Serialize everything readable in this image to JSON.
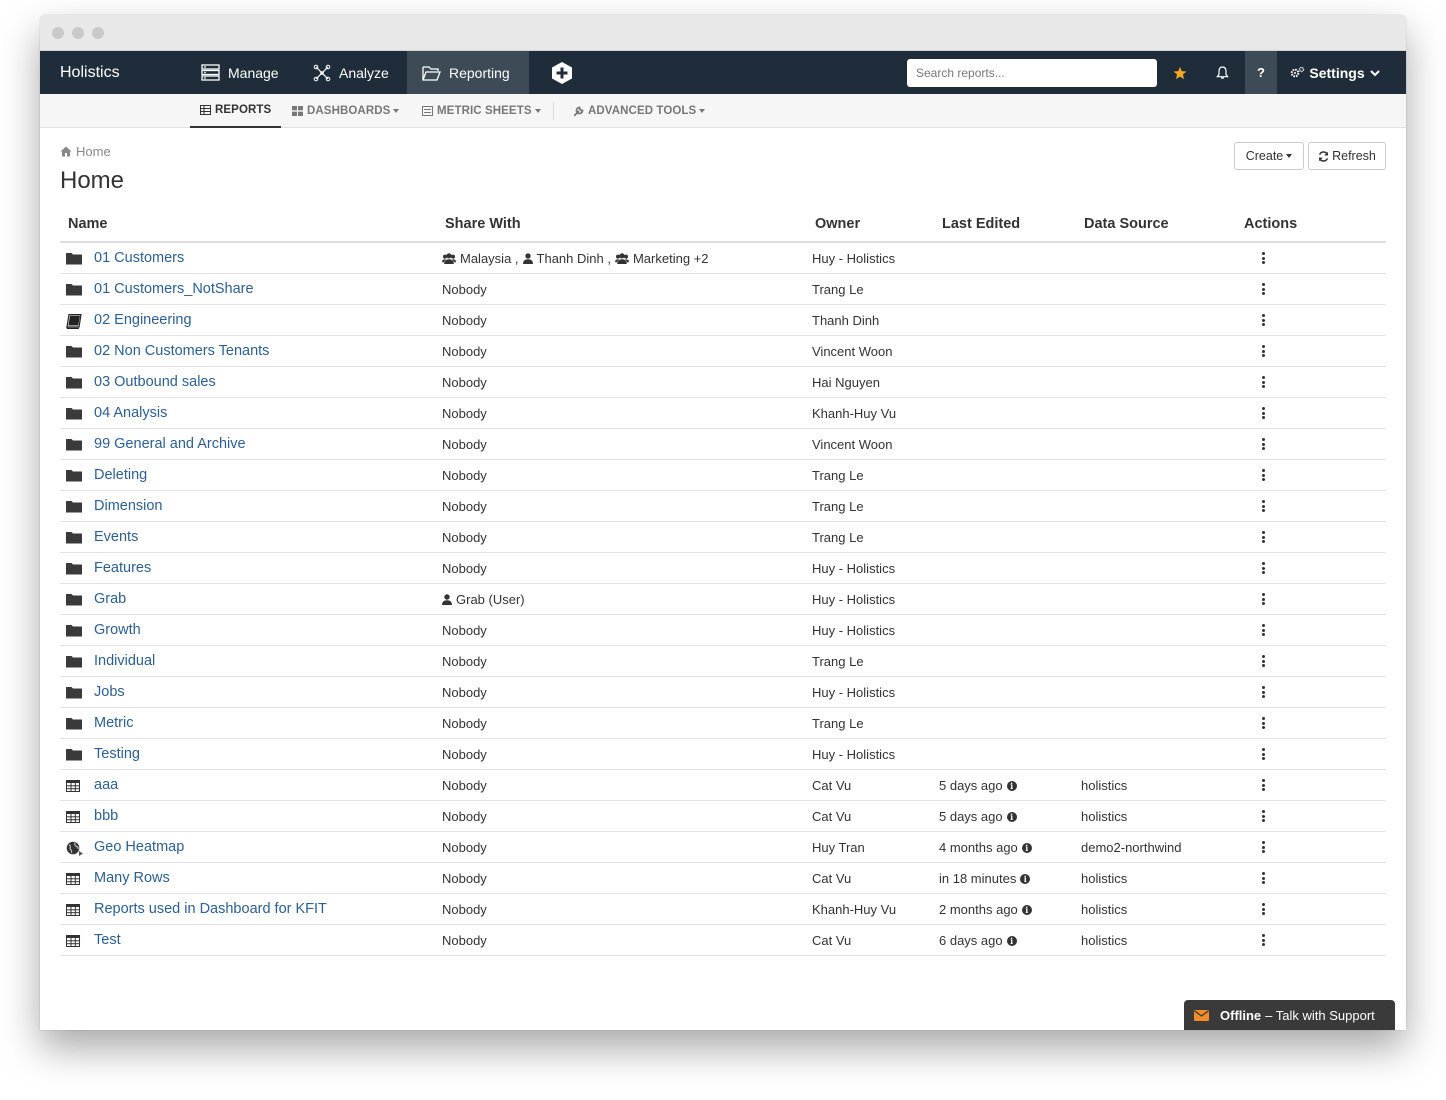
{
  "app": {
    "brand": "Holistics",
    "nav": [
      {
        "label": "Manage",
        "icon": "server-icon"
      },
      {
        "label": "Analyze",
        "icon": "molecule-icon"
      },
      {
        "label": "Reporting",
        "icon": "folder-open-icon"
      }
    ],
    "search_placeholder": "Search reports...",
    "help_label": "?",
    "settings_label": "Settings"
  },
  "subnav": [
    {
      "label": "REPORTS",
      "icon": "table-icon"
    },
    {
      "label": "DASHBOARDS",
      "icon": "grid-icon"
    },
    {
      "label": "METRIC SHEETS",
      "icon": "list-icon"
    },
    {
      "label": "ADVANCED TOOLS",
      "icon": "wrench-icon"
    }
  ],
  "breadcrumb": "Home",
  "page_title": "Home",
  "buttons": {
    "create": "Create",
    "refresh": "Refresh"
  },
  "table": {
    "headers": [
      "Name",
      "Share With",
      "Owner",
      "Last Edited",
      "Data Source",
      "Actions"
    ],
    "rows": [
      {
        "icon": "folder",
        "name": "01 Customers",
        "share": "",
        "share_parts": [
          {
            "icon": "users",
            "text": "Malaysia ,"
          },
          {
            "icon": "user",
            "text": "Thanh Dinh ,"
          },
          {
            "icon": "users",
            "text": "Marketing +2"
          }
        ],
        "owner": "Huy - Holistics",
        "edited": "",
        "source": ""
      },
      {
        "icon": "folder",
        "name": "01 Customers_NotShare",
        "share": "Nobody",
        "owner": "Trang Le",
        "edited": "",
        "source": ""
      },
      {
        "icon": "book",
        "name": "02 Engineering",
        "share": "Nobody",
        "owner": "Thanh Dinh",
        "edited": "",
        "source": ""
      },
      {
        "icon": "folder",
        "name": "02 Non Customers Tenants",
        "share": "Nobody",
        "owner": "Vincent Woon",
        "edited": "",
        "source": ""
      },
      {
        "icon": "folder",
        "name": "03 Outbound sales",
        "share": "Nobody",
        "owner": "Hai Nguyen",
        "edited": "",
        "source": ""
      },
      {
        "icon": "folder",
        "name": "04 Analysis",
        "share": "Nobody",
        "owner": "Khanh-Huy Vu",
        "edited": "",
        "source": ""
      },
      {
        "icon": "folder",
        "name": "99 General and Archive",
        "share": "Nobody",
        "owner": "Vincent Woon",
        "edited": "",
        "source": ""
      },
      {
        "icon": "folder",
        "name": "Deleting",
        "share": "Nobody",
        "owner": "Trang Le",
        "edited": "",
        "source": ""
      },
      {
        "icon": "folder",
        "name": "Dimension",
        "share": "Nobody",
        "owner": "Trang Le",
        "edited": "",
        "source": ""
      },
      {
        "icon": "folder",
        "name": "Events",
        "share": "Nobody",
        "owner": "Trang Le",
        "edited": "",
        "source": ""
      },
      {
        "icon": "folder",
        "name": "Features",
        "share": "Nobody",
        "owner": "Huy - Holistics",
        "edited": "",
        "source": ""
      },
      {
        "icon": "folder",
        "name": "Grab",
        "share": "",
        "share_parts": [
          {
            "icon": "user",
            "text": "Grab (User)"
          }
        ],
        "owner": "Huy - Holistics",
        "edited": "",
        "source": ""
      },
      {
        "icon": "folder",
        "name": "Growth",
        "share": "Nobody",
        "owner": "Huy - Holistics",
        "edited": "",
        "source": ""
      },
      {
        "icon": "folder",
        "name": "Individual",
        "share": "Nobody",
        "owner": "Trang Le",
        "edited": "",
        "source": ""
      },
      {
        "icon": "folder",
        "name": "Jobs",
        "share": "Nobody",
        "owner": "Huy - Holistics",
        "edited": "",
        "source": ""
      },
      {
        "icon": "folder",
        "name": "Metric",
        "share": "Nobody",
        "owner": "Trang Le",
        "edited": "",
        "source": ""
      },
      {
        "icon": "folder",
        "name": "Testing",
        "share": "Nobody",
        "owner": "Huy - Holistics",
        "edited": "",
        "source": ""
      },
      {
        "icon": "table",
        "name": "aaa",
        "share": "Nobody",
        "owner": "Cat Vu",
        "edited": "5 days ago",
        "source": "holistics"
      },
      {
        "icon": "table",
        "name": "bbb",
        "share": "Nobody",
        "owner": "Cat Vu",
        "edited": "5 days ago",
        "source": "holistics"
      },
      {
        "icon": "globe",
        "name": "Geo Heatmap",
        "share": "Nobody",
        "owner": "Huy Tran",
        "edited": "4 months ago",
        "source": "demo2-northwind"
      },
      {
        "icon": "table",
        "name": "Many Rows",
        "share": "Nobody",
        "owner": "Cat Vu",
        "edited": "in 18 minutes",
        "source": "holistics"
      },
      {
        "icon": "table",
        "name": "Reports used in Dashboard for KFIT",
        "share": "Nobody",
        "owner": "Khanh-Huy Vu",
        "edited": "2 months ago",
        "source": "holistics"
      },
      {
        "icon": "table",
        "name": "Test",
        "share": "Nobody",
        "owner": "Cat Vu",
        "edited": "6 days ago",
        "source": "holistics"
      }
    ]
  },
  "support": {
    "status": "Offline",
    "text": "– Talk with Support"
  },
  "colors": {
    "nav_bg": "#1f2d3a",
    "nav_active": "#3d4b57",
    "link": "#2d5f8f",
    "star": "#f5a623",
    "envelope": "#f08c2b"
  }
}
